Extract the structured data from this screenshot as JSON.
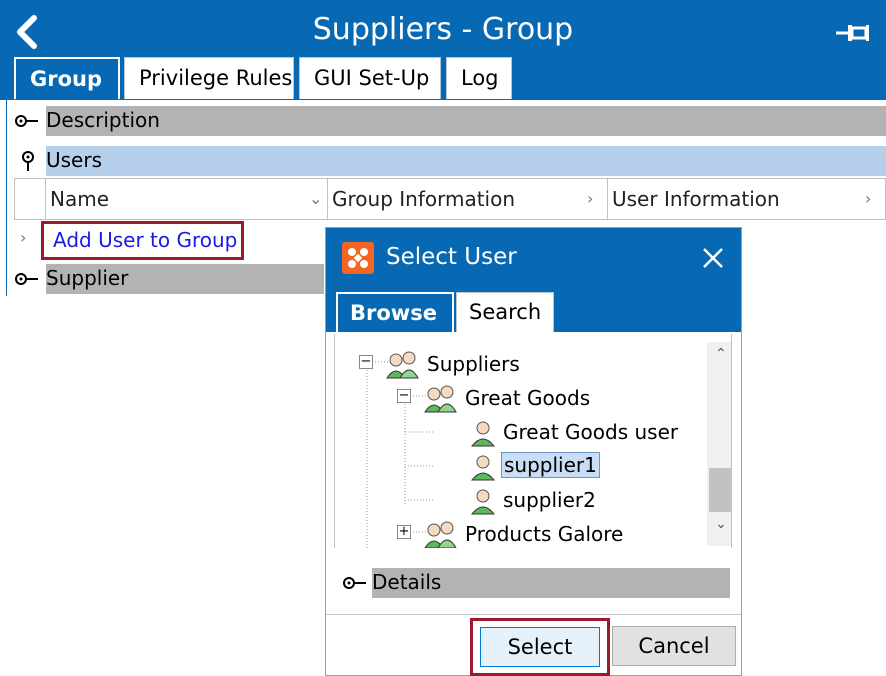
{
  "window": {
    "title": "Suppliers - Group",
    "tabs": [
      {
        "label": "Group",
        "active": true
      },
      {
        "label": "Privilege Rules",
        "active": false
      },
      {
        "label": "GUI Set-Up",
        "active": false
      },
      {
        "label": "Log",
        "active": false
      }
    ]
  },
  "sections": {
    "description": "Description",
    "users": "Users",
    "supplier": "Supplier"
  },
  "grid": {
    "columns": [
      "Name",
      "Group Information",
      "User Information"
    ],
    "add_row_label": "Add User to Group"
  },
  "dialog": {
    "title": "Select User",
    "tabs": [
      {
        "label": "Browse",
        "active": true
      },
      {
        "label": "Search",
        "active": false
      }
    ],
    "tree": [
      {
        "label": "Suppliers",
        "type": "group",
        "level": 0,
        "expanded": true
      },
      {
        "label": "Great Goods",
        "type": "group",
        "level": 1,
        "expanded": true
      },
      {
        "label": "Great Goods user",
        "type": "user",
        "level": 2
      },
      {
        "label": "supplier1",
        "type": "user",
        "level": 2,
        "selected": true
      },
      {
        "label": "supplier2",
        "type": "user",
        "level": 2
      },
      {
        "label": "Products Galore",
        "type": "group",
        "level": 1,
        "expanded": false
      }
    ],
    "details_label": "Details",
    "select_label": "Select",
    "cancel_label": "Cancel"
  },
  "colors": {
    "primary": "#0769b3",
    "highlight_border": "#9b1b2b",
    "section_gray": "#b3b3b3",
    "section_blue": "#b6d0ec",
    "link": "#1a1ae6"
  }
}
